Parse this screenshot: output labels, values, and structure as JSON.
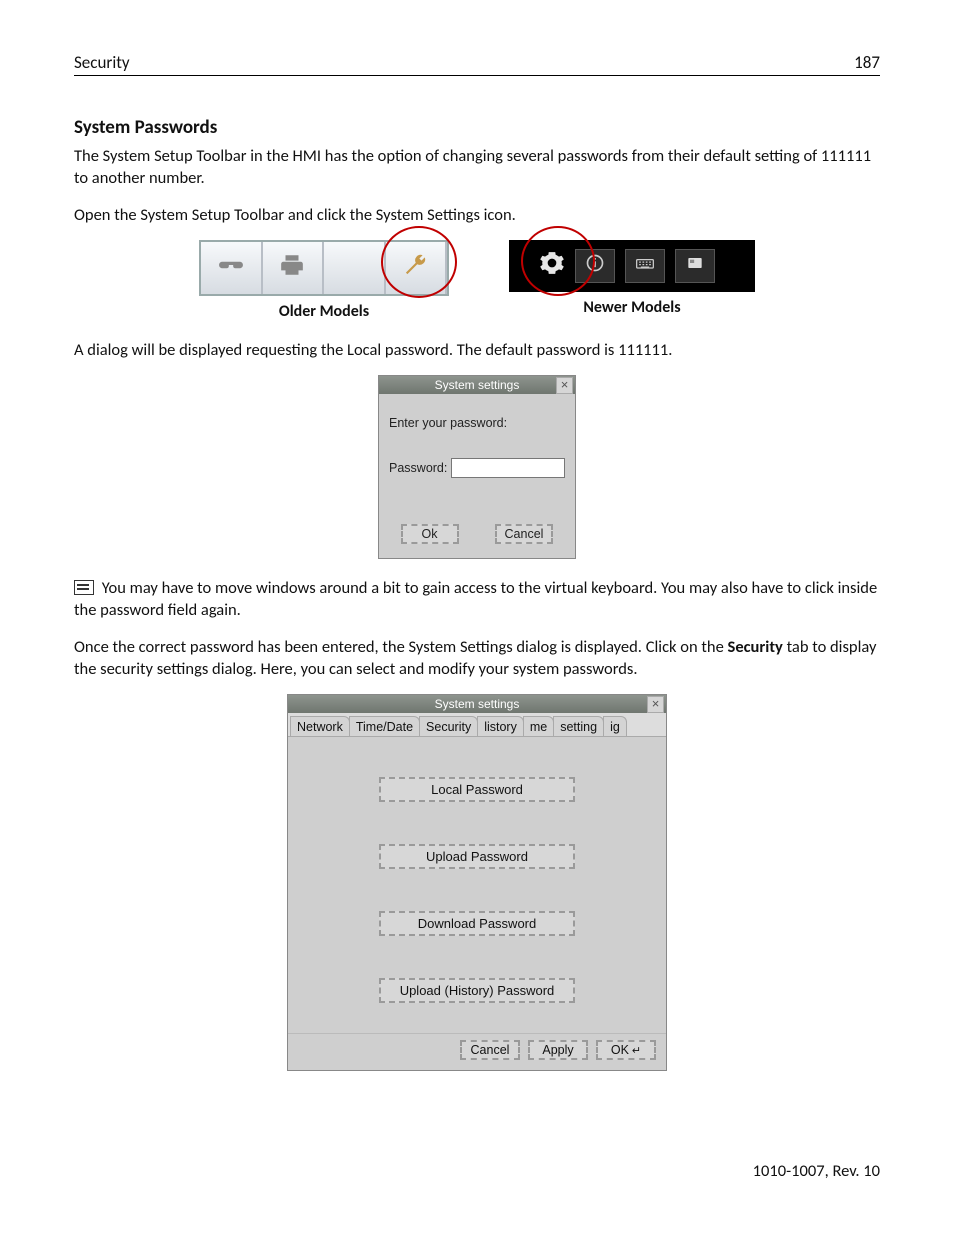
{
  "header": {
    "section": "Security",
    "page_number": "187"
  },
  "title": "System Passwords",
  "para1": "The System Setup Toolbar in the HMI has the option of changing several passwords from their default setting of 111111 to another number.",
  "para2": "Open the System Setup Toolbar and click the System Settings icon.",
  "models": {
    "older": "Older Models",
    "newer": "Newer Models"
  },
  "para3": "A dialog will be displayed requesting the Local password. The default password is 111111.",
  "dlg1": {
    "title": "System settings",
    "prompt": "Enter your password:",
    "pw_label": "Password:",
    "ok": "Ok",
    "cancel": "Cancel"
  },
  "note": "You may have to move windows around a bit to gain access to the virtual keyboard. You may also have to click inside the password field again.",
  "para4a": "Once the correct password has been entered, the System Settings dialog is displayed. Click on the ",
  "para4b": "Security",
  "para4c": " tab to display the security settings dialog. Here, you can select and modify your system passwords.",
  "dlg2": {
    "title": "System settings",
    "tabs": [
      "Network",
      "Time/Date",
      "Security",
      "listory",
      "me",
      "setting",
      "ig"
    ],
    "buttons": [
      "Local Password",
      "Upload Password",
      "Download Password",
      "Upload (History) Password"
    ],
    "cancel": "Cancel",
    "apply": "Apply",
    "ok": "OK"
  },
  "footer_rev": "1010-1007, Rev. 10"
}
